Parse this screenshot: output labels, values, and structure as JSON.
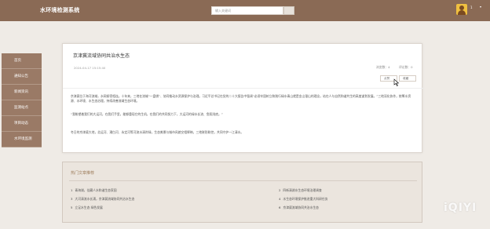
{
  "header": {
    "title": "水环境检测系统",
    "search_placeholder": "输入关键词",
    "username": "1",
    "caret": "▾"
  },
  "sidebar": {
    "items": [
      {
        "label": "首页"
      },
      {
        "label": "通知公告"
      },
      {
        "label": "新闻资讯"
      },
      {
        "label": "监测站点"
      },
      {
        "label": "项目动态"
      },
      {
        "label": "水环境监测"
      }
    ]
  },
  "article": {
    "title": "京津冀流域协同共治水生态",
    "date": "2024-04-17 15:15:40",
    "views": "浏览数：4",
    "comments": "评论数：0",
    "like_label": "点赞",
    "fav_label": "收藏",
    "paragraphs": [
      "京津冀位于海河流域，水网紧密相连。十年来，三地在流域“一盘棋”、协同推动水资源保护与治理。习近平总书记在党的二十大报告中强调“必须牢固树立和践行绿水青山就是金山银山的理念，站在人与自然和谐共生的高度谋划发展。”三地深化协作，统筹水资源、水环境、水生态治理，持续改善流域生态环境。",
      "“我盼望着我们的大运河，在我们手里，能够重现它的生机，在我们的共同努力下，大运河的绿水长流、鱼翔浅底。”",
      "冬日的京津冀大地，北运河、潮白河、永定河等河流水清岸绿，生态美景与城市风貌交相辉映。三地联防联控，共同守护一江清水。"
    ]
  },
  "recommend": {
    "title": "热门文章推荐",
    "items": [
      {
        "num": "1",
        "text": "青海湖，佳藏人水和谐生态家园"
      },
      {
        "num": "2",
        "text": "四新清湖水生态环境治理调查"
      },
      {
        "num": "3",
        "text": "大河清流水长涌，京津冀流域协同共治水生态"
      },
      {
        "num": "4",
        "text": "水生态环境保护推进重大科研任务"
      },
      {
        "num": "5",
        "text": "立足水生态 绿色发展"
      },
      {
        "num": "6",
        "text": "京津冀流域协同共治水生态"
      }
    ]
  },
  "watermark": "iQIYI"
}
